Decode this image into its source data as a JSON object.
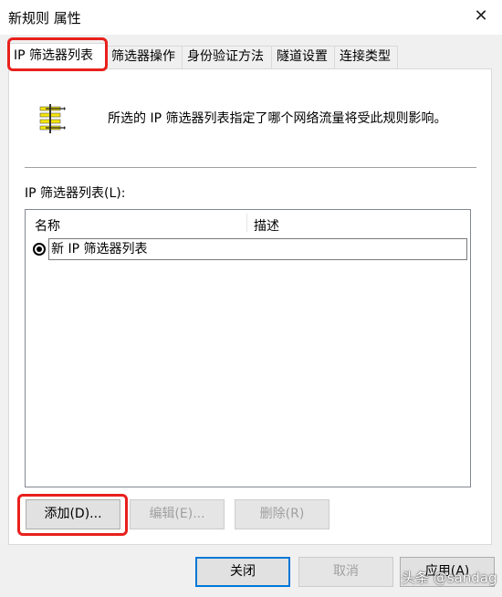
{
  "window": {
    "title": "新规则 属性",
    "close_glyph": "✕"
  },
  "tabs": [
    {
      "label": "IP 筛选器列表"
    },
    {
      "label": "筛选器操作"
    },
    {
      "label": "身份验证方法"
    },
    {
      "label": "隧道设置"
    },
    {
      "label": "连接类型"
    }
  ],
  "info": {
    "icon": "filter-list-icon",
    "text": "所选的 IP 筛选器列表指定了哪个网络流量将受此规则影响。"
  },
  "list": {
    "label": "IP 筛选器列表(L):",
    "columns": [
      "名称",
      "描述"
    ],
    "rows": [
      {
        "name": "新 IP 筛选器列表",
        "description": "",
        "selected": true
      }
    ]
  },
  "buttons": {
    "add": "添加(D)...",
    "edit": "编辑(E)...",
    "delete": "删除(R)",
    "close": "关闭",
    "cancel": "取消",
    "apply": "应用(A)"
  },
  "watermark": "头条 @sandag",
  "colors": {
    "highlight": "#e8201c",
    "accent": "#0078d7"
  }
}
